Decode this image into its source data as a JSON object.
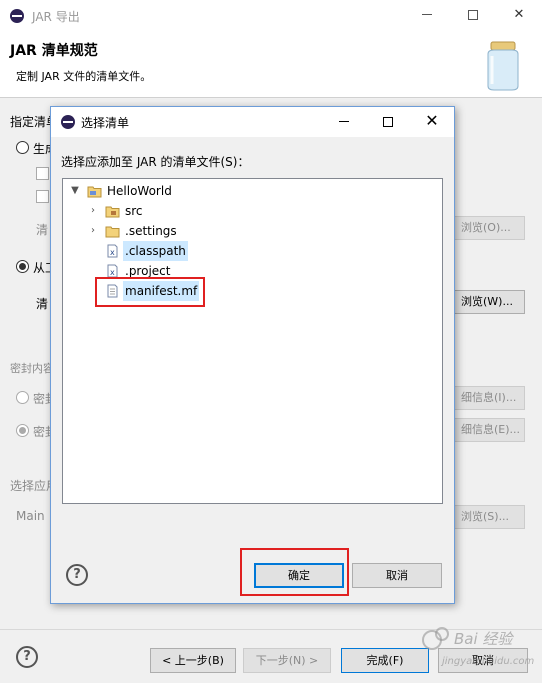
{
  "outer_window": {
    "title": "JAR 导出",
    "header_title": "JAR 清单规范",
    "header_desc": "定制 JAR 文件的清单文件。",
    "body": {
      "spec_label": "指定清单",
      "radio_generate": "生成",
      "manifest_label_1": "清",
      "browse_1": "浏览(O)...",
      "radio_from_workspace": "从工",
      "manifest_label_2": "清",
      "browse_2": "浏览(W)...",
      "seal_label": "密封内容",
      "radio_seal_1": "密封",
      "details_1": "细信息(I)...",
      "radio_seal_2": "密封",
      "details_2": "细信息(E)...",
      "select_label": "选择应用",
      "main_label": "Main",
      "browse_3": "浏览(S)..."
    },
    "footer": {
      "back": "< 上一步(B)",
      "next": "下一步(N) >",
      "finish": "完成(F)",
      "cancel": "取消"
    }
  },
  "dialog": {
    "title": "选择清单",
    "prompt": "选择应添加至 JAR 的清单文件(S)：",
    "tree": [
      {
        "label": "HelloWorld",
        "icon": "project-folder-icon",
        "twisty": "expanded"
      },
      {
        "label": "src",
        "icon": "package-folder-icon",
        "twisty": "collapsed"
      },
      {
        "label": ".settings",
        "icon": "folder-icon",
        "twisty": "collapsed"
      },
      {
        "label": ".classpath",
        "icon": "xml-file-icon",
        "twisty": "none",
        "selected": true
      },
      {
        "label": ".project",
        "icon": "xml-file-icon",
        "twisty": "none"
      },
      {
        "label": "manifest.mf",
        "icon": "text-file-icon",
        "twisty": "none",
        "selected": true
      }
    ],
    "ok": "确定",
    "cancel": "取消"
  },
  "watermark": "Bai 经验\njingyan.baidu.com",
  "colors": {
    "highlight_red": "#e02020",
    "selection": "#cce8ff",
    "focus_blue": "#0078d7"
  }
}
